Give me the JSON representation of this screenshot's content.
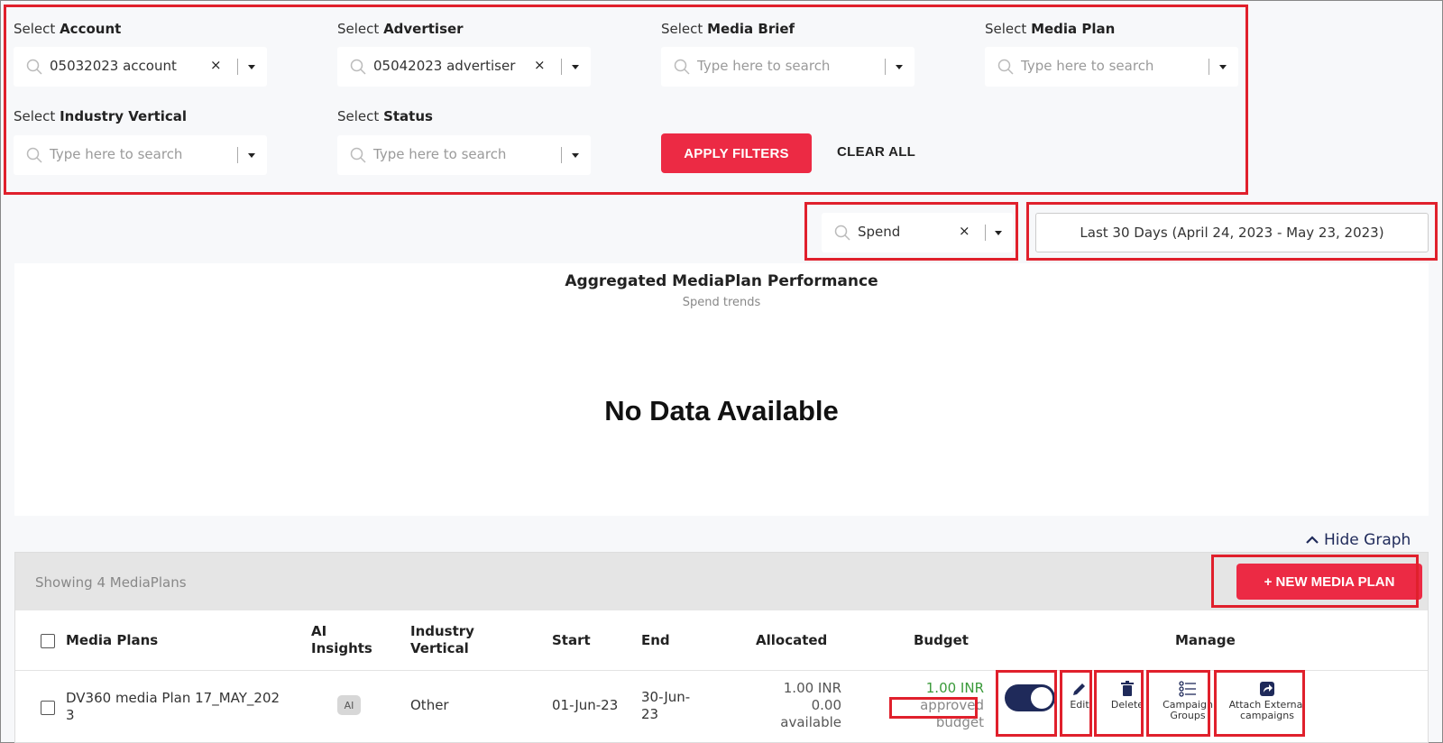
{
  "filters": {
    "account": {
      "label_prefix": "Select",
      "label_bold": "Account",
      "value": "05032023 account"
    },
    "advertiser": {
      "label_prefix": "Select",
      "label_bold": "Advertiser",
      "value": "05042023 advertiser"
    },
    "media_brief": {
      "label_prefix": "Select",
      "label_bold": "Media Brief",
      "placeholder": "Type here to search"
    },
    "media_plan": {
      "label_prefix": "Select",
      "label_bold": "Media Plan",
      "placeholder": "Type here to search"
    },
    "industry_vertical": {
      "label_prefix": "Select",
      "label_bold": "Industry Vertical",
      "placeholder": "Type here to search"
    },
    "status": {
      "label_prefix": "Select",
      "label_bold": "Status",
      "placeholder": "Type here to search"
    },
    "apply_label": "APPLY FILTERS",
    "clear_label": "CLEAR ALL",
    "clear_x": "×"
  },
  "metric_select": {
    "value": "Spend"
  },
  "date_range": "Last 30 Days (April 24, 2023 - May 23, 2023)",
  "chart": {
    "title": "Aggregated MediaPlan Performance",
    "subtitle": "Spend trends",
    "empty_message": "No Data Available",
    "hide_label": "Hide Graph"
  },
  "table": {
    "showing": "Showing 4 MediaPlans",
    "new_button": "+ NEW MEDIA PLAN",
    "columns": {
      "media_plans": "Media Plans",
      "ai_insights_1": "AI",
      "ai_insights_2": "Insights",
      "industry_1": "Industry",
      "industry_2": "Vertical",
      "start": "Start",
      "end": "End",
      "allocated": "Allocated",
      "budget": "Budget",
      "manage": "Manage"
    },
    "rows": [
      {
        "name_1": "DV360 media Plan 17_MAY_202",
        "name_2": "3",
        "ai_badge": "AI",
        "industry": "Other",
        "start": "01-Jun-23",
        "end_1": "30-Jun-",
        "end_2": "23",
        "allocated_1": "1.00 INR",
        "allocated_2": "0.00",
        "allocated_3": "available",
        "budget_1": "1.00 INR",
        "budget_2": "approved",
        "budget_3": "budget",
        "actions": {
          "edit": "Edit",
          "delete": "Delete",
          "campaign_groups_1": "Campaign",
          "campaign_groups_2": "Groups",
          "attach_1": "Attach External",
          "attach_2": "campaigns"
        }
      }
    ]
  },
  "colors": {
    "accent": "#ec2a44",
    "navy": "#1f2a5a",
    "highlight": "#e0202c",
    "budget_green": "#3a9a3a"
  },
  "icons": [
    "search-icon",
    "clear-icon",
    "chevron-down-icon",
    "chevron-up-icon",
    "edit-icon",
    "delete-icon",
    "list-icon",
    "share-icon"
  ]
}
